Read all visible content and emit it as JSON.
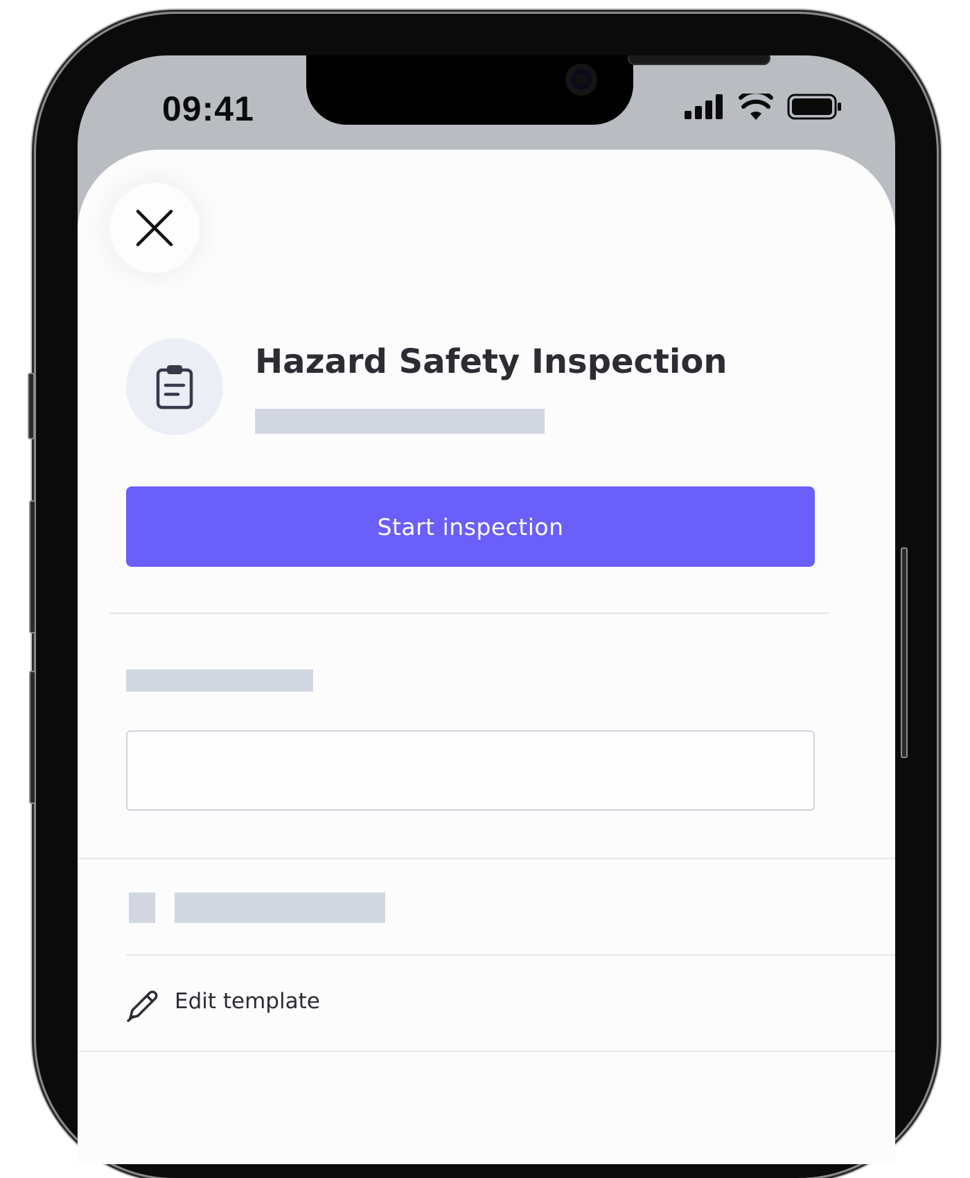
{
  "status_bar": {
    "time": "09:41",
    "icons": [
      "cellular-signal-icon",
      "wifi-icon",
      "battery-icon"
    ]
  },
  "close_button": {
    "icon": "close-icon"
  },
  "template": {
    "icon": "clipboard-icon",
    "title": "Hazard Safety Inspection"
  },
  "actions": {
    "start_label": "Start inspection",
    "edit_icon": "pencil-icon",
    "edit_label": "Edit template"
  },
  "colors": {
    "accent": "#6a5ff8",
    "skeleton": "#d2d7e1",
    "status_bar_bg": "#b9bcc1",
    "avatar_bg": "#eceef5"
  }
}
